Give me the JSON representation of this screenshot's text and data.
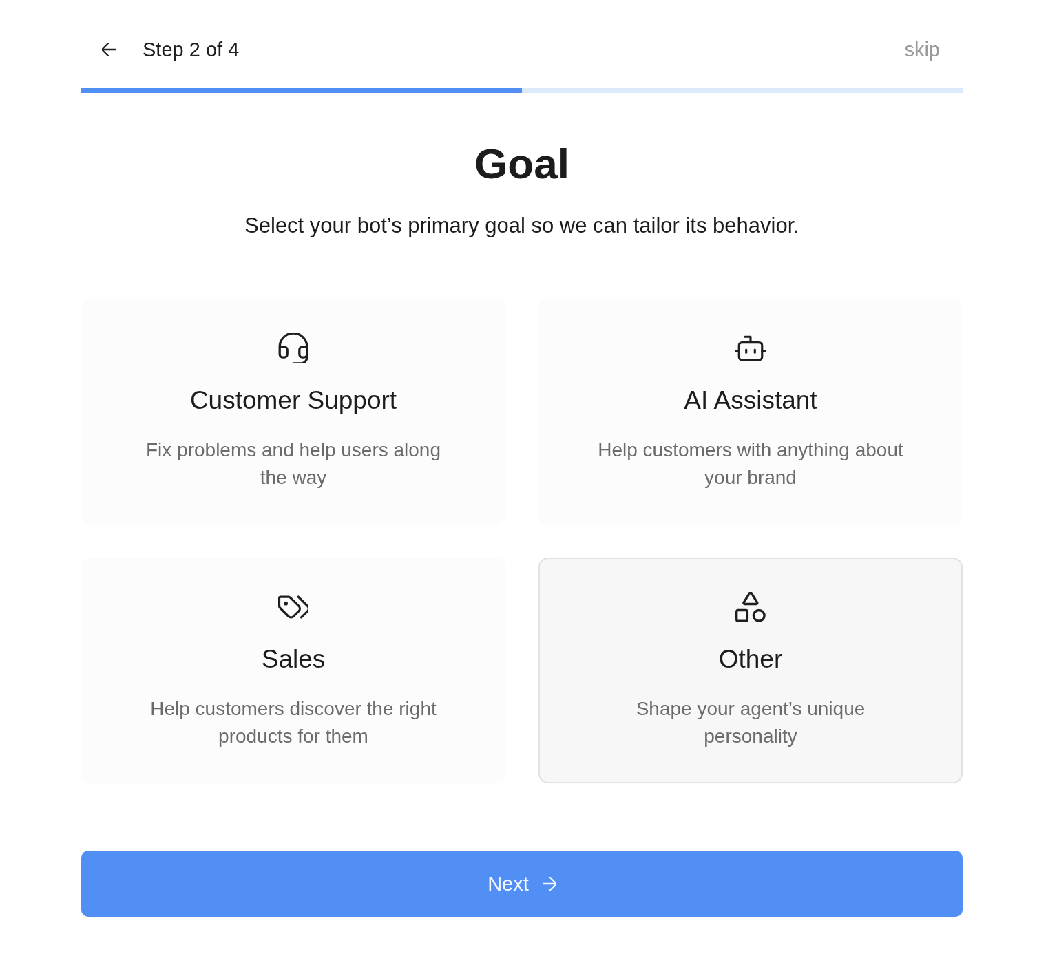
{
  "header": {
    "step": "Step 2 of 4",
    "skip": "skip"
  },
  "progress": {
    "level": 0.5
  },
  "title": "Goal",
  "subtitle": "Select your bot’s primary goal so we can tailor its behavior.",
  "options": [
    {
      "title": "Customer Support",
      "description": "Fix problems and help users along the way",
      "selected": false
    },
    {
      "title": "AI Assistant",
      "description": "Help customers with anything about your brand",
      "selected": false
    },
    {
      "title": "Sales",
      "description": "Help customers discover the right products for them",
      "selected": false
    },
    {
      "title": "Other",
      "description": "Shape your agent’s unique personality",
      "selected": true
    }
  ],
  "next_button": {
    "label": "Next"
  }
}
